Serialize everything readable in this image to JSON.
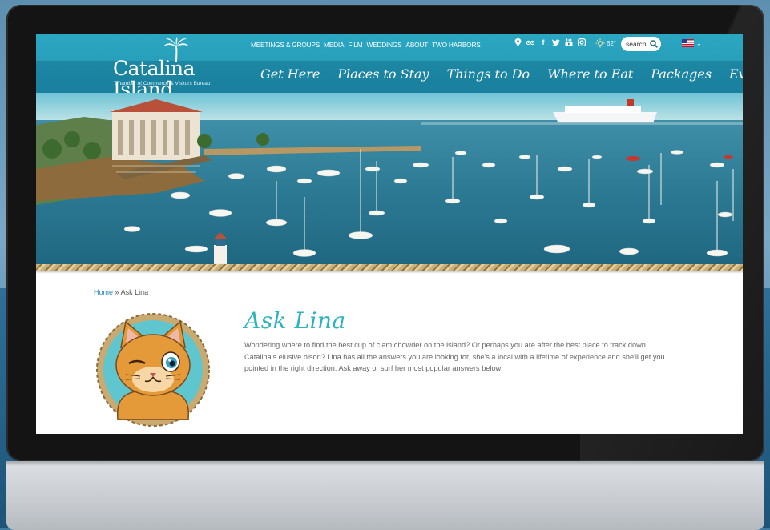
{
  "site": {
    "logo_main": "Catalina Island",
    "logo_sub": "Chamber of Commerce & Visitors Bureau"
  },
  "utility_nav": [
    "MEETINGS & GROUPS",
    "MEDIA",
    "FILM",
    "WEDDINGS",
    "ABOUT",
    "TWO HARBORS"
  ],
  "social_icons": [
    "map-pin-icon",
    "tripadvisor-icon",
    "facebook-icon",
    "twitter-icon",
    "youtube-icon",
    "instagram-icon"
  ],
  "weather": {
    "icon": "sun-icon",
    "temp": "62°"
  },
  "search": {
    "placeholder": "search"
  },
  "language": {
    "flag": "us-flag-icon"
  },
  "main_nav": [
    "Get Here",
    "Places to Stay",
    "Things to Do",
    "Where to Eat",
    "Packages",
    "Events"
  ],
  "breadcrumb": {
    "home": "Home",
    "separator": "»",
    "current": "Ask Lina"
  },
  "page": {
    "title": "Ask Lina",
    "intro": "Wondering where to find the best cup of clam chowder on the island? Or perhaps you are after the best place to track down Catalina's elusive bison? Lina has all the answers you are looking for, she's a local with a lifetime of experience and she'll get you pointed in the right direction. Ask away or surf her most popular answers below!"
  },
  "colors": {
    "header": "#2396b3",
    "title": "#2bb3c0",
    "link": "#2a86b4"
  }
}
